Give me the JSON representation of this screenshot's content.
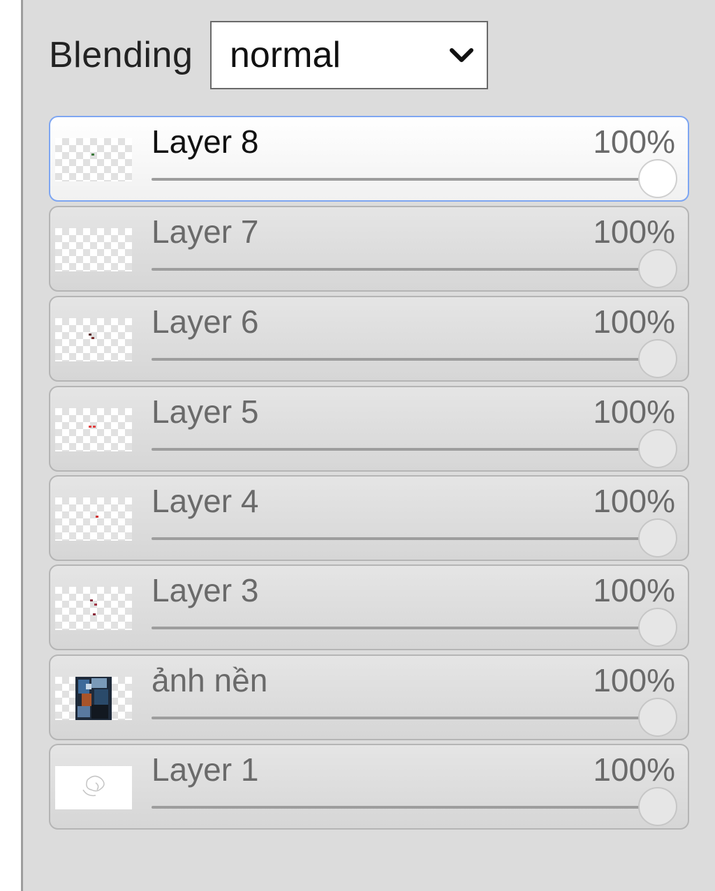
{
  "blending": {
    "label": "Blending",
    "selected": "normal"
  },
  "layers": [
    {
      "name": "Layer 8",
      "opacity": "100%",
      "opacity_value": 1.0,
      "active": true,
      "thumb": "transparent"
    },
    {
      "name": "Layer 7",
      "opacity": "100%",
      "opacity_value": 1.0,
      "active": false,
      "thumb": "transparent"
    },
    {
      "name": "Layer 6",
      "opacity": "100%",
      "opacity_value": 1.0,
      "active": false,
      "thumb": "transparent"
    },
    {
      "name": "Layer 5",
      "opacity": "100%",
      "opacity_value": 1.0,
      "active": false,
      "thumb": "transparent"
    },
    {
      "name": "Layer 4",
      "opacity": "100%",
      "opacity_value": 1.0,
      "active": false,
      "thumb": "transparent"
    },
    {
      "name": "Layer 3",
      "opacity": "100%",
      "opacity_value": 1.0,
      "active": false,
      "thumb": "transparent"
    },
    {
      "name": "ảnh nền",
      "opacity": "100%",
      "opacity_value": 1.0,
      "active": false,
      "thumb": "photo"
    },
    {
      "name": "Layer 1",
      "opacity": "100%",
      "opacity_value": 1.0,
      "active": false,
      "thumb": "white"
    }
  ],
  "colors": {
    "panel_bg": "#dcdcdc",
    "active_border": "#7ea6f2",
    "inactive_text": "#6a6a6a"
  }
}
